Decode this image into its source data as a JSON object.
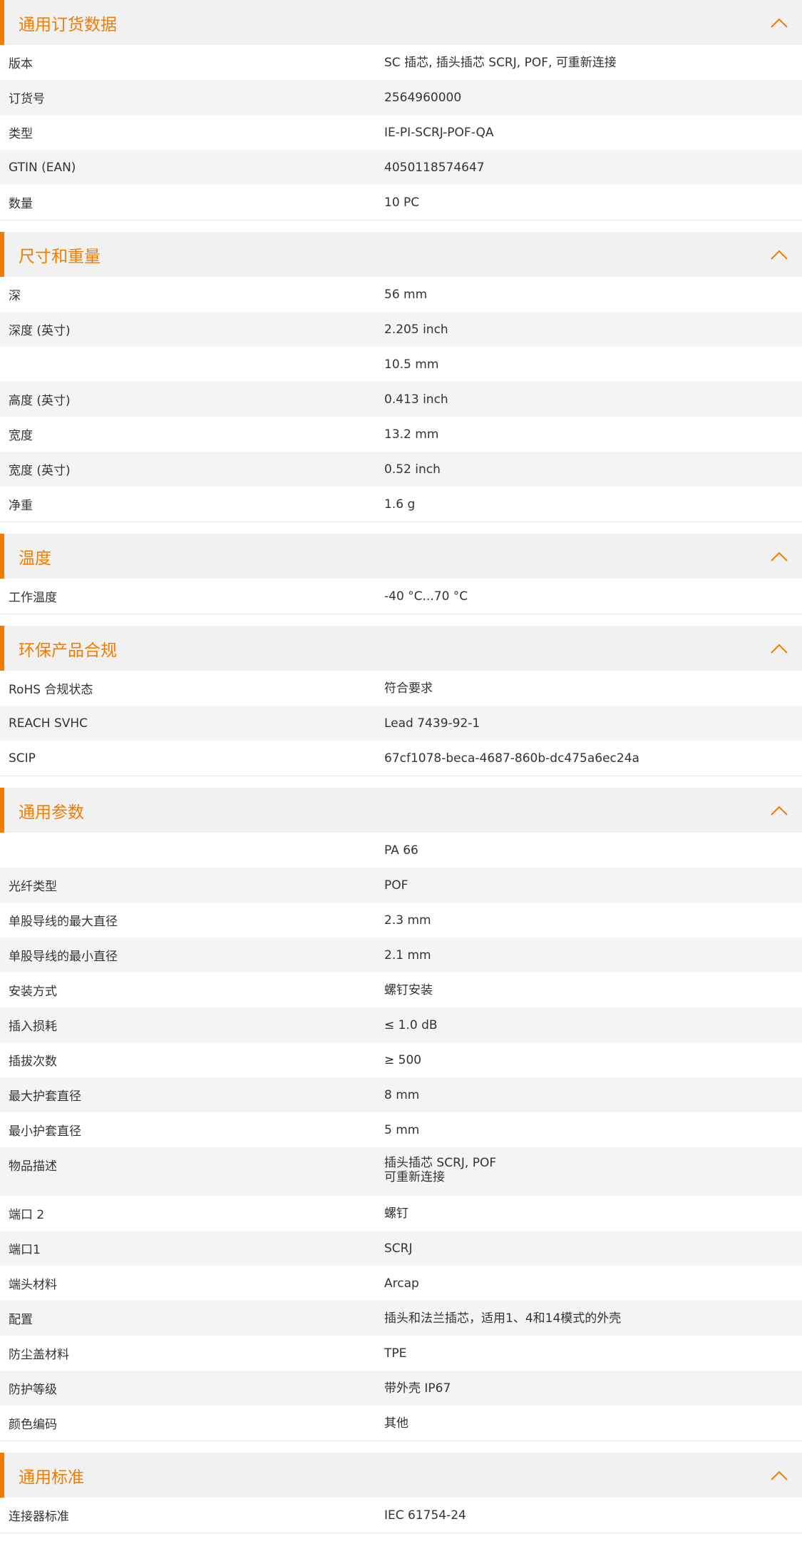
{
  "colors": {
    "accent": "#f07d00",
    "header_bg": "#f1f1f1",
    "row_alt_bg": "#f4f4f4"
  },
  "icons": {
    "collapse": "chevron-up-icon"
  },
  "sections": [
    {
      "title": "通用订货数据",
      "rows": [
        {
          "label": "版本",
          "value": "SC 插芯, 插头插芯 SCRJ, POF, 可重新连接"
        },
        {
          "label": "订货号",
          "value": "2564960000"
        },
        {
          "label": "类型",
          "value": "IE-PI-SCRJ-POF-QA"
        },
        {
          "label": "GTIN (EAN)",
          "value": "4050118574647"
        },
        {
          "label": "数量",
          "value": "10  PC"
        }
      ]
    },
    {
      "title": "尺寸和重量",
      "rows": [
        {
          "label": "深",
          "value": "56  mm"
        },
        {
          "label": "深度 (英寸)",
          "value": "2.205  inch"
        },
        {
          "label": "",
          "value": "10.5  mm"
        },
        {
          "label": "高度 (英寸)",
          "value": "0.413  inch"
        },
        {
          "label": "宽度",
          "value": "13.2  mm"
        },
        {
          "label": "宽度 (英寸)",
          "value": "0.52  inch"
        },
        {
          "label": "净重",
          "value": "1.6  g"
        }
      ]
    },
    {
      "title": "温度",
      "rows": [
        {
          "label": "工作温度",
          "value": "-40 °C...70 °C"
        }
      ]
    },
    {
      "title": "环保产品合规",
      "rows": [
        {
          "label": "RoHS 合规状态",
          "value": "符合要求"
        },
        {
          "label": "REACH SVHC",
          "value": "Lead 7439-92-1"
        },
        {
          "label": "SCIP",
          "value": "67cf1078-beca-4687-860b-dc475a6ec24a"
        }
      ]
    },
    {
      "title": "通用参数",
      "rows": [
        {
          "label": "",
          "value": "PA 66"
        },
        {
          "label": "光纤类型",
          "value": "POF"
        },
        {
          "label": "单股导线的最大直径",
          "value": "2.3  mm"
        },
        {
          "label": "单股导线的最小直径",
          "value": "2.1  mm"
        },
        {
          "label": "安装方式",
          "value": "螺钉安装"
        },
        {
          "label": "插入损耗",
          "value": "≤ 1.0 dB"
        },
        {
          "label": "插拔次数",
          "value": "≥ 500"
        },
        {
          "label": "最大护套直径",
          "value": "8  mm"
        },
        {
          "label": "最小护套直径",
          "value": "5  mm"
        },
        {
          "label": "物品描述",
          "value": "插头插芯 SCRJ, POF\n可重新连接",
          "multiline": true
        },
        {
          "label": "端口 2",
          "value": "螺钉"
        },
        {
          "label": "端口1",
          "value": "SCRJ"
        },
        {
          "label": "端头材料",
          "value": "Arcap"
        },
        {
          "label": "配置",
          "value": "插头和法兰插芯，适用1、4和14模式的外壳"
        },
        {
          "label": "防尘盖材料",
          "value": "TPE"
        },
        {
          "label": "防护等级",
          "value": "带外壳 IP67"
        },
        {
          "label": "颜色编码",
          "value": "其他"
        }
      ]
    },
    {
      "title": "通用标准",
      "rows": [
        {
          "label": "连接器标准",
          "value": "IEC 61754-24"
        }
      ]
    }
  ]
}
